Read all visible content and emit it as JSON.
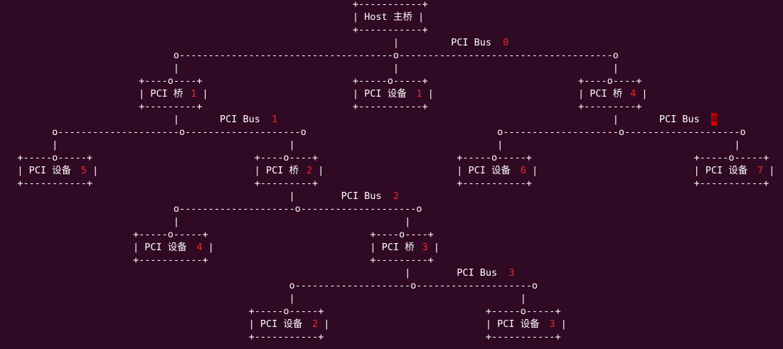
{
  "terminal": {
    "background": "#300a24",
    "foreground": "#ffffff",
    "accent": "#ef2929",
    "cursor_highlight": "#cc0000",
    "lines": [
      {
        "segments": [
          {
            "col": 61,
            "text": "+-----------+"
          }
        ]
      },
      {
        "segments": [
          {
            "col": 61,
            "text": "| Host 主桥 |"
          }
        ]
      },
      {
        "segments": [
          {
            "col": 61,
            "text": "+-----------+"
          }
        ]
      },
      {
        "segments": [
          {
            "col": 68,
            "text": "|"
          },
          {
            "col": 78,
            "text": "PCI Bus "
          },
          {
            "col": 87,
            "text": "0",
            "style": "red"
          }
        ]
      },
      {
        "segments": [
          {
            "col": 30,
            "text": "o-------------------------------------o-------------------------------------o"
          }
        ]
      },
      {
        "segments": [
          {
            "col": 30,
            "text": "|"
          },
          {
            "col": 68,
            "text": "|"
          },
          {
            "col": 106,
            "text": "|"
          }
        ]
      },
      {
        "segments": [
          {
            "col": 24,
            "text": "+----o----+"
          },
          {
            "col": 61,
            "text": "+-----o-----+"
          },
          {
            "col": 100,
            "text": "+----o----+"
          }
        ]
      },
      {
        "segments": [
          {
            "col": 24,
            "text": "| PCI 桥"
          },
          {
            "col": 33,
            "text": "1",
            "style": "red"
          },
          {
            "col": 35,
            "text": "|"
          },
          {
            "col": 61,
            "text": "| PCI 设备"
          },
          {
            "col": 72,
            "text": "1",
            "style": "red"
          },
          {
            "col": 74,
            "text": "|"
          },
          {
            "col": 100,
            "text": "| PCI 桥"
          },
          {
            "col": 109,
            "text": "4",
            "style": "red"
          },
          {
            "col": 111,
            "text": "|"
          }
        ]
      },
      {
        "segments": [
          {
            "col": 24,
            "text": "+---------+"
          },
          {
            "col": 61,
            "text": "+-----------+"
          },
          {
            "col": 100,
            "text": "+---------+"
          }
        ]
      },
      {
        "segments": [
          {
            "col": 30,
            "text": "|"
          },
          {
            "col": 38,
            "text": "PCI Bus "
          },
          {
            "col": 47,
            "text": "1",
            "style": "red"
          },
          {
            "col": 106,
            "text": "|"
          },
          {
            "col": 114,
            "text": "PCI Bus "
          },
          {
            "col": 123,
            "text": "4",
            "style": "redbg"
          }
        ]
      },
      {
        "segments": [
          {
            "col": 9,
            "text": "o---------------------o--------------------o"
          },
          {
            "col": 86,
            "text": "o--------------------o--------------------o"
          }
        ]
      },
      {
        "segments": [
          {
            "col": 9,
            "text": "|"
          },
          {
            "col": 50,
            "text": "|"
          },
          {
            "col": 86,
            "text": "|"
          },
          {
            "col": 127,
            "text": "|"
          }
        ]
      },
      {
        "segments": [
          {
            "col": 3,
            "text": "+-----o-----+"
          },
          {
            "col": 44,
            "text": "+----o----+"
          },
          {
            "col": 79,
            "text": "+-----o-----+"
          },
          {
            "col": 120,
            "text": "+-----o-----+"
          }
        ]
      },
      {
        "segments": [
          {
            "col": 3,
            "text": "| PCI 设备"
          },
          {
            "col": 14,
            "text": "5",
            "style": "red"
          },
          {
            "col": 16,
            "text": "|"
          },
          {
            "col": 44,
            "text": "| PCI 桥"
          },
          {
            "col": 53,
            "text": "2",
            "style": "red"
          },
          {
            "col": 55,
            "text": "|"
          },
          {
            "col": 79,
            "text": "| PCI 设备"
          },
          {
            "col": 90,
            "text": "6",
            "style": "red"
          },
          {
            "col": 92,
            "text": "|"
          },
          {
            "col": 120,
            "text": "| PCI 设备"
          },
          {
            "col": 131,
            "text": "7",
            "style": "red"
          },
          {
            "col": 133,
            "text": "|"
          }
        ]
      },
      {
        "segments": [
          {
            "col": 3,
            "text": "+-----------+"
          },
          {
            "col": 44,
            "text": "+---------+"
          },
          {
            "col": 79,
            "text": "+-----------+"
          },
          {
            "col": 120,
            "text": "+-----------+"
          }
        ]
      },
      {
        "segments": [
          {
            "col": 50,
            "text": "|"
          },
          {
            "col": 59,
            "text": "PCI Bus "
          },
          {
            "col": 68,
            "text": "2",
            "style": "red"
          }
        ]
      },
      {
        "segments": [
          {
            "col": 30,
            "text": "o--------------------o--------------------o"
          }
        ]
      },
      {
        "segments": [
          {
            "col": 30,
            "text": "|"
          },
          {
            "col": 70,
            "text": "|"
          }
        ]
      },
      {
        "segments": [
          {
            "col": 23,
            "text": "+-----o-----+"
          },
          {
            "col": 64,
            "text": "+----o----+"
          }
        ]
      },
      {
        "segments": [
          {
            "col": 23,
            "text": "| PCI 设备"
          },
          {
            "col": 34,
            "text": "4",
            "style": "red"
          },
          {
            "col": 36,
            "text": "|"
          },
          {
            "col": 64,
            "text": "| PCI 桥"
          },
          {
            "col": 73,
            "text": "3",
            "style": "red"
          },
          {
            "col": 75,
            "text": "|"
          }
        ]
      },
      {
        "segments": [
          {
            "col": 23,
            "text": "+-----------+"
          },
          {
            "col": 64,
            "text": "+---------+"
          }
        ]
      },
      {
        "segments": [
          {
            "col": 70,
            "text": "|"
          },
          {
            "col": 79,
            "text": "PCI Bus "
          },
          {
            "col": 88,
            "text": "3",
            "style": "red"
          }
        ]
      },
      {
        "segments": [
          {
            "col": 50,
            "text": "o--------------------o--------------------o"
          }
        ]
      },
      {
        "segments": [
          {
            "col": 50,
            "text": "|"
          },
          {
            "col": 90,
            "text": "|"
          }
        ]
      },
      {
        "segments": [
          {
            "col": 43,
            "text": "+-----o-----+"
          },
          {
            "col": 84,
            "text": "+-----o-----+"
          }
        ]
      },
      {
        "segments": [
          {
            "col": 43,
            "text": "| PCI 设备"
          },
          {
            "col": 54,
            "text": "2",
            "style": "red"
          },
          {
            "col": 56,
            "text": "|"
          },
          {
            "col": 84,
            "text": "| PCI 设备"
          },
          {
            "col": 95,
            "text": "3",
            "style": "red"
          },
          {
            "col": 97,
            "text": "|"
          }
        ]
      },
      {
        "segments": [
          {
            "col": 43,
            "text": "+-----------+"
          },
          {
            "col": 84,
            "text": "+-----------+"
          }
        ]
      }
    ]
  }
}
